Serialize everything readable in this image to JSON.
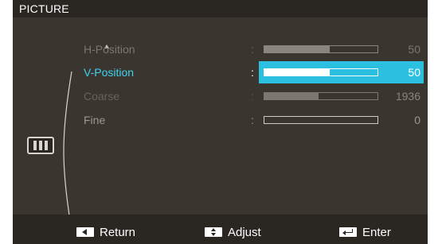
{
  "title": "PICTURE",
  "icons": {
    "scroll_up": "up-arrow-icon",
    "category": "picture-category-icon"
  },
  "colors": {
    "highlight": "#2bc0e0",
    "selected_text": "#3fd2f0",
    "panel_bg": "#3a352f",
    "bar_bg": "#2a2621"
  },
  "items": [
    {
      "label": "H-Position",
      "colon": ":",
      "value": "50",
      "level": 0.58,
      "state": "normal"
    },
    {
      "label": "V-Position",
      "colon": ":",
      "value": "50",
      "level": 0.58,
      "state": "selected"
    },
    {
      "label": "Coarse",
      "colon": ":",
      "value": "1936",
      "level": 0.48,
      "state": "dim"
    },
    {
      "label": "Fine",
      "colon": ":",
      "value": "0",
      "level": 0.0,
      "state": "enabled"
    }
  ],
  "footer": {
    "return_label": "Return",
    "adjust_label": "Adjust",
    "enter_label": "Enter",
    "return_icon": "left-arrow-key-icon",
    "adjust_icon": "up-down-key-icon",
    "enter_icon": "enter-key-icon"
  }
}
